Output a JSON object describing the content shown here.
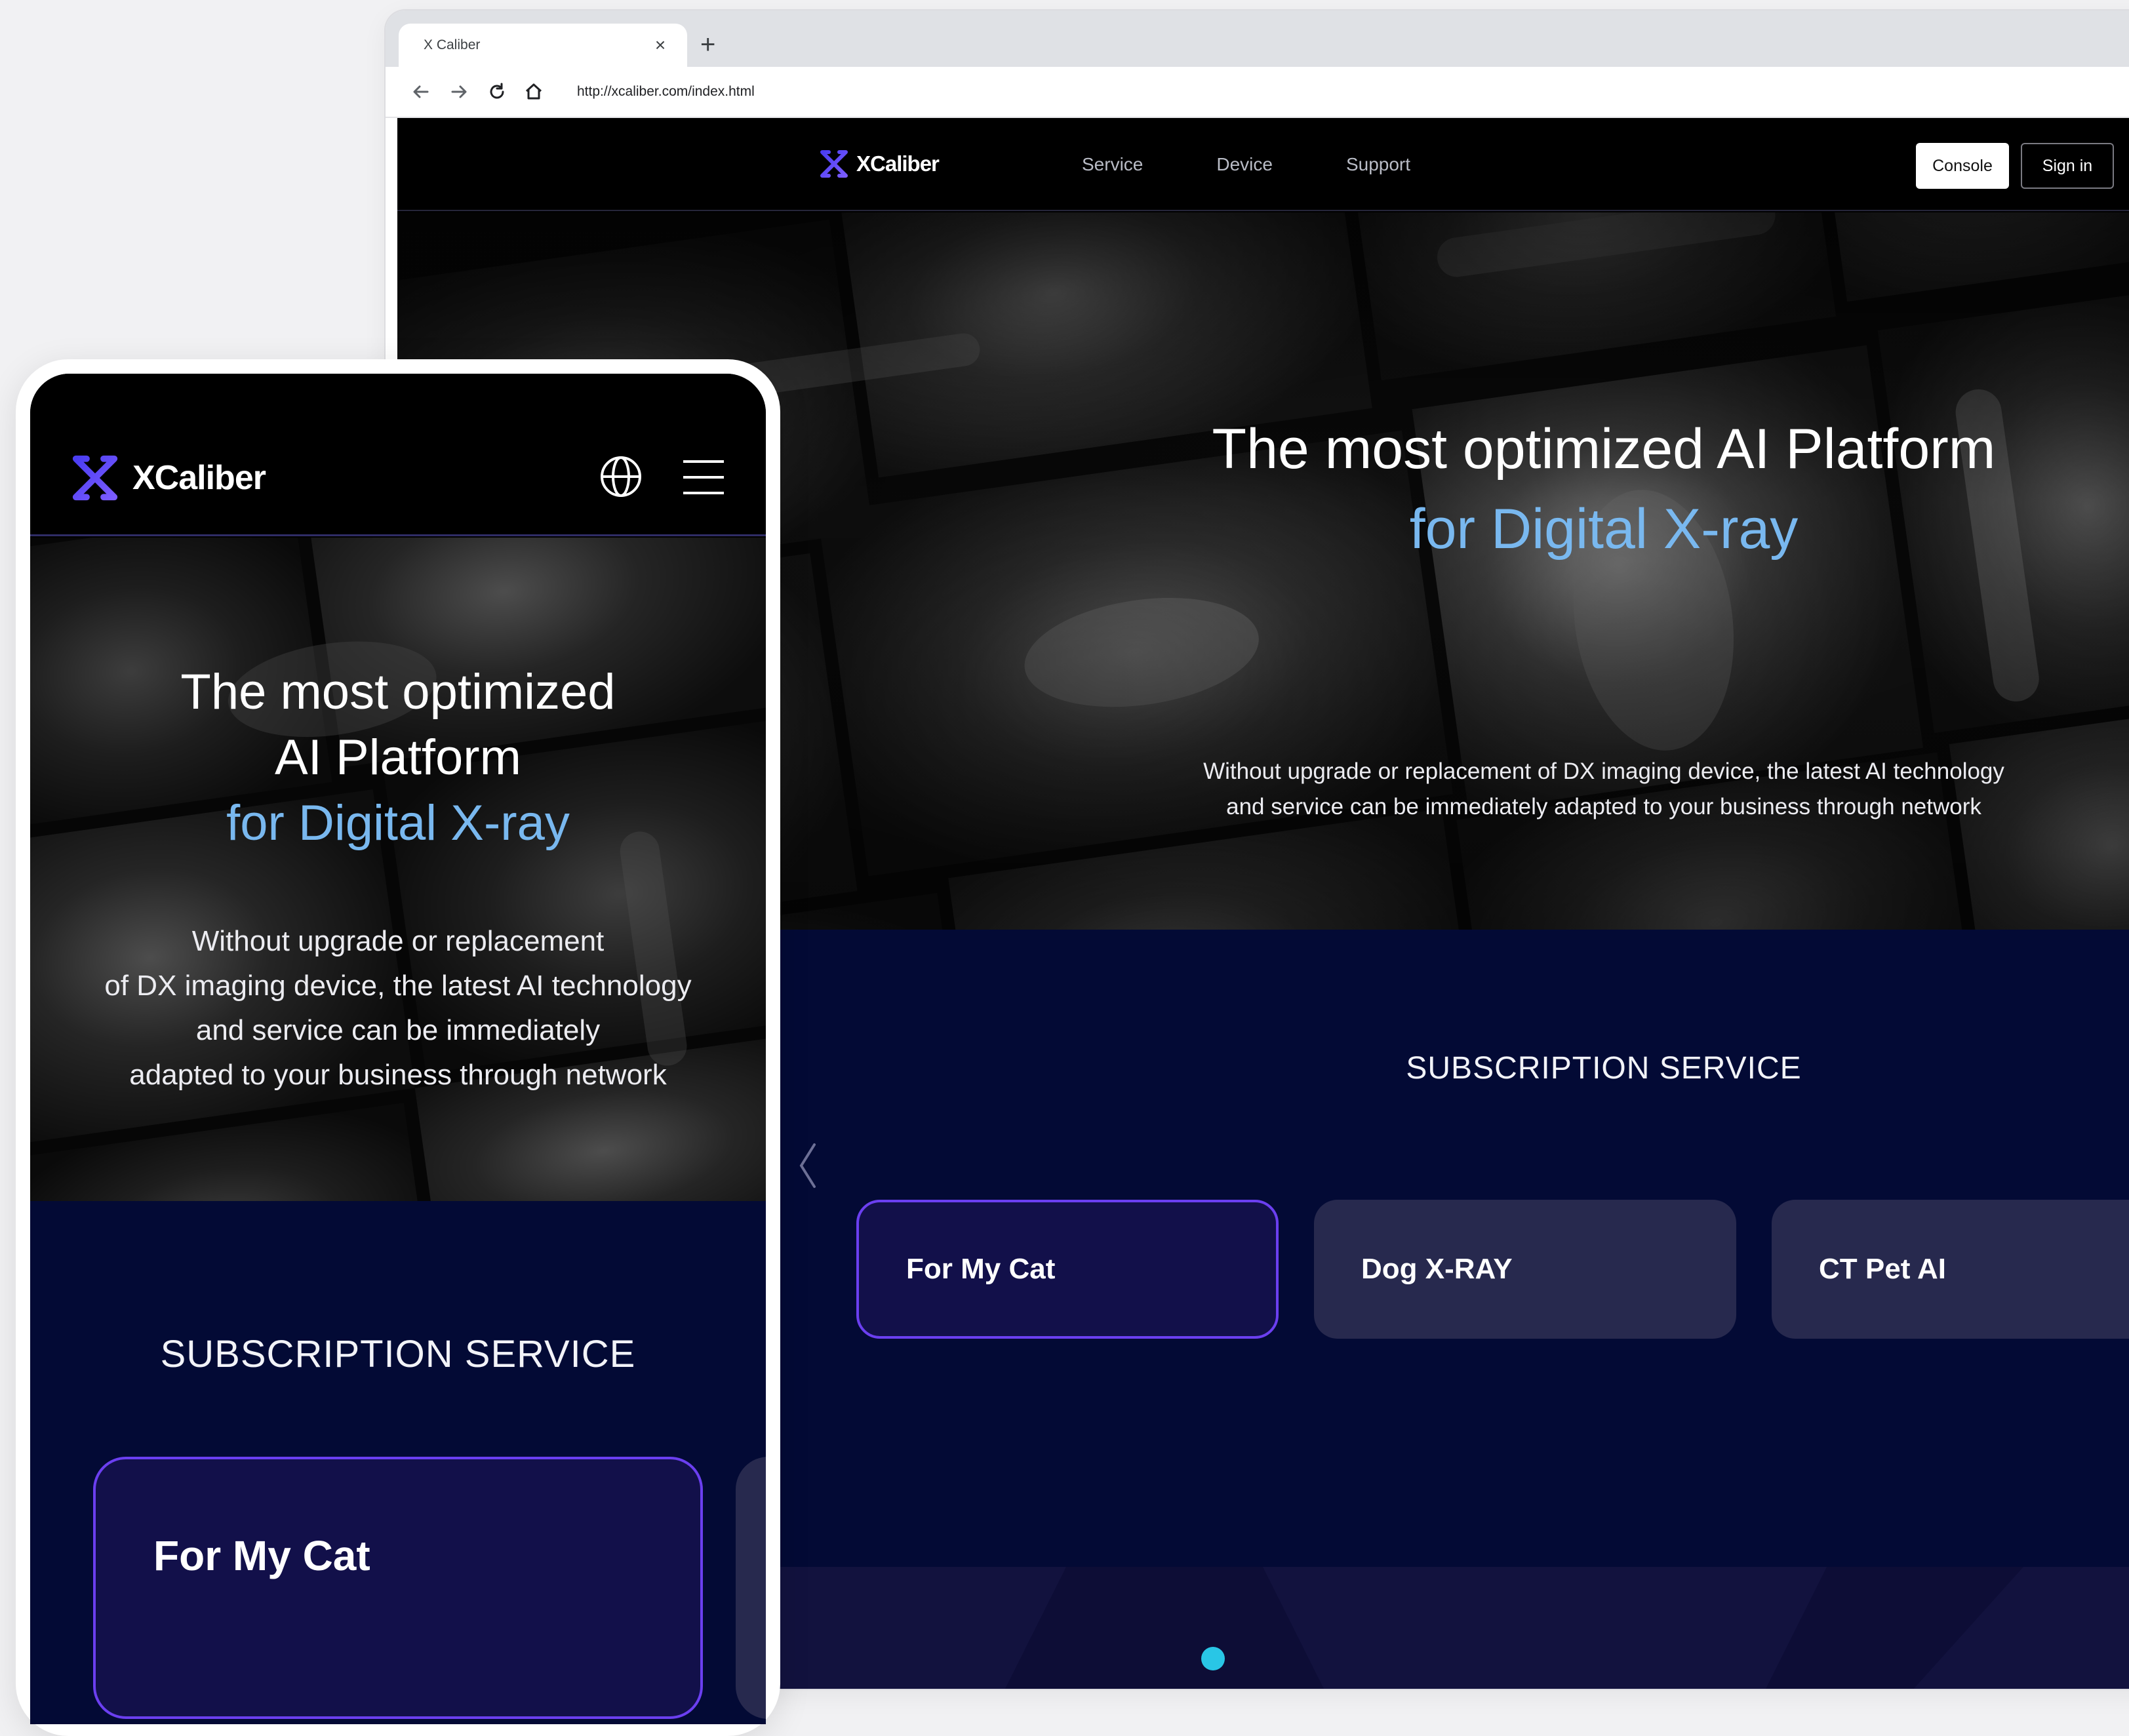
{
  "browser": {
    "tab_title": "X Caliber",
    "tab_close_icon": "close-icon",
    "new_tab_icon": "plus-icon",
    "url": "http://xcaliber.com/index.html",
    "nav_icons": [
      "back-arrow-icon",
      "forward-arrow-icon",
      "reload-icon",
      "home-icon"
    ]
  },
  "site": {
    "logo_text": "XCaliber",
    "nav": [
      "Service",
      "Device",
      "Support"
    ],
    "console_label": "Console",
    "signin_label": "Sign in",
    "hero": {
      "title_line1": "The most optimized AI Platform",
      "title_line2": "for Digital X-ray",
      "subtitle_line1": "Without upgrade or replacement of DX imaging device, the latest AI technology",
      "subtitle_line2": "and service can be immediately adapted to your business through network"
    },
    "subscription": {
      "title": "SUBSCRIPTION SERVICE",
      "cards": [
        "For My Cat",
        "Dog X-RAY",
        "CT Pet AI"
      ],
      "active_index": 0
    }
  },
  "mobile": {
    "logo_text": "XCaliber",
    "globe_icon": "globe-icon",
    "menu_icon": "hamburger-menu-icon",
    "hero": {
      "title_line1": "The most optimized",
      "title_line2": "AI Platform",
      "title_line3": "for Digital X-ray",
      "subtitle_lines": [
        "Without upgrade or replacement",
        "of DX imaging device, the latest AI technology",
        "and service can be immediately",
        "adapted to your business through network"
      ]
    },
    "subscription": {
      "title": "SUBSCRIPTION SERVICE",
      "card_label": "For My Cat"
    }
  },
  "colors": {
    "accent_purple": "#6b3ff0",
    "hero_highlight": "#79b8ef",
    "navy_background": "#030a35",
    "card_inactive": "#27294e",
    "logo_gradient_start": "#4a3df2",
    "logo_gradient_end": "#7b5cff"
  }
}
